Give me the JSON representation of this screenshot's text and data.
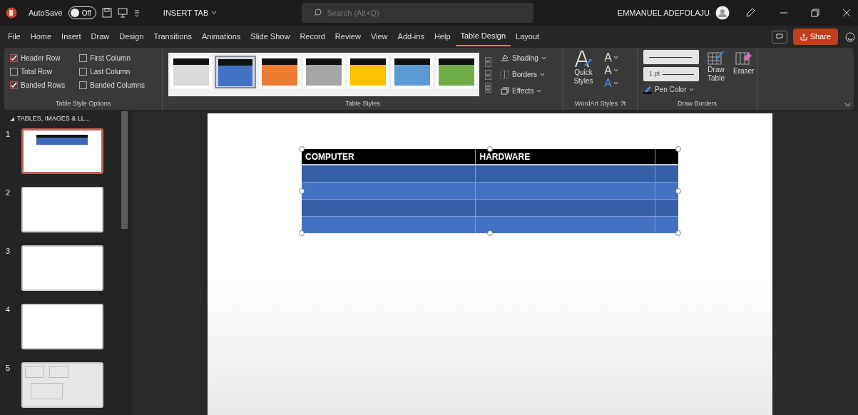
{
  "title_bar": {
    "autosave_label": "AutoSave",
    "autosave_toggle": {
      "label": "Off",
      "on": false
    },
    "document_title": "INSERT TAB",
    "search": {
      "placeholder": "Search (Alt+Q)"
    },
    "user_name": "EMMANUEL ADEFOLAJU"
  },
  "menu_tabs": [
    {
      "label": "File",
      "selected": false
    },
    {
      "label": "Home",
      "selected": false
    },
    {
      "label": "Insert",
      "selected": false
    },
    {
      "label": "Draw",
      "selected": false
    },
    {
      "label": "Design",
      "selected": false
    },
    {
      "label": "Transitions",
      "selected": false
    },
    {
      "label": "Animations",
      "selected": false
    },
    {
      "label": "Slide Show",
      "selected": false
    },
    {
      "label": "Record",
      "selected": false
    },
    {
      "label": "Review",
      "selected": false
    },
    {
      "label": "View",
      "selected": false
    },
    {
      "label": "Add-ins",
      "selected": false
    },
    {
      "label": "Help",
      "selected": false
    },
    {
      "label": "Table Design",
      "selected": true
    },
    {
      "label": "Layout",
      "selected": false
    }
  ],
  "share_button": "Share",
  "ribbon": {
    "table_style_options": {
      "label": "Table Style Options",
      "options": [
        {
          "label": "Header Row",
          "checked": true
        },
        {
          "label": "First Column",
          "checked": false
        },
        {
          "label": "Total Row",
          "checked": false
        },
        {
          "label": "Last Column",
          "checked": false
        },
        {
          "label": "Banded Rows",
          "checked": true
        },
        {
          "label": "Banded Columns",
          "checked": false
        }
      ]
    },
    "table_styles": {
      "label": "Table Styles",
      "items": [
        {
          "color": "#d9d9d9",
          "selected": false
        },
        {
          "color": "#4472c4",
          "selected": true
        },
        {
          "color": "#ed7d31",
          "selected": false
        },
        {
          "color": "#a5a5a5",
          "selected": false
        },
        {
          "color": "#ffc000",
          "selected": false
        },
        {
          "color": "#5b9bd5",
          "selected": false
        },
        {
          "color": "#70ad47",
          "selected": false
        }
      ],
      "buttons": [
        "Shading",
        "Borders",
        "Effects"
      ]
    },
    "wordart_styles": {
      "label": "WordArt Styles",
      "quick_styles": "Quick Styles"
    },
    "draw_borders": {
      "label": "Draw Borders",
      "pen_weight": "1 pt",
      "pen_color": "Pen Color",
      "draw_table": "Draw Table",
      "eraser": "Eraser"
    }
  },
  "slides_panel": {
    "section": "TABLES, IMAGES & LL...",
    "slides": [
      {
        "number": "1",
        "kind": "table",
        "selected": true
      },
      {
        "number": "2",
        "kind": "blank",
        "selected": false
      },
      {
        "number": "3",
        "kind": "blank",
        "selected": false
      },
      {
        "number": "4",
        "kind": "blank",
        "selected": false
      },
      {
        "number": "5",
        "kind": "layout",
        "selected": false
      }
    ]
  },
  "slide_table": {
    "headings": [
      "COMPUTER",
      "HARDWARE"
    ]
  }
}
